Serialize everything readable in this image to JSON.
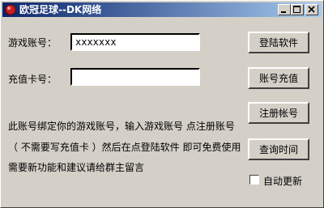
{
  "window": {
    "title": "欧冠足球--DK网络"
  },
  "form": {
    "game_account_label": "游戏账号：",
    "game_account_value": "xxxxxxx",
    "card_label": "充值卡号：",
    "card_value": ""
  },
  "buttons": {
    "login": "登陆软件",
    "recharge": "账号充值",
    "register": "注册帐号",
    "query_time": "查询时间"
  },
  "info_lines": [
    "此账号绑定你的游戏账号，输入游戏账号 点注册账号",
    "（ 不需要写充值卡 ）然后在点登陆软件 即可免费使用",
    "需要新功能和建议请给群主留言"
  ],
  "auto_update": {
    "label": "自动更新",
    "checked": false
  },
  "colors": {
    "titlebar_start": "#0a246a",
    "titlebar_end": "#a6caf0",
    "face": "#d4d0c8"
  }
}
